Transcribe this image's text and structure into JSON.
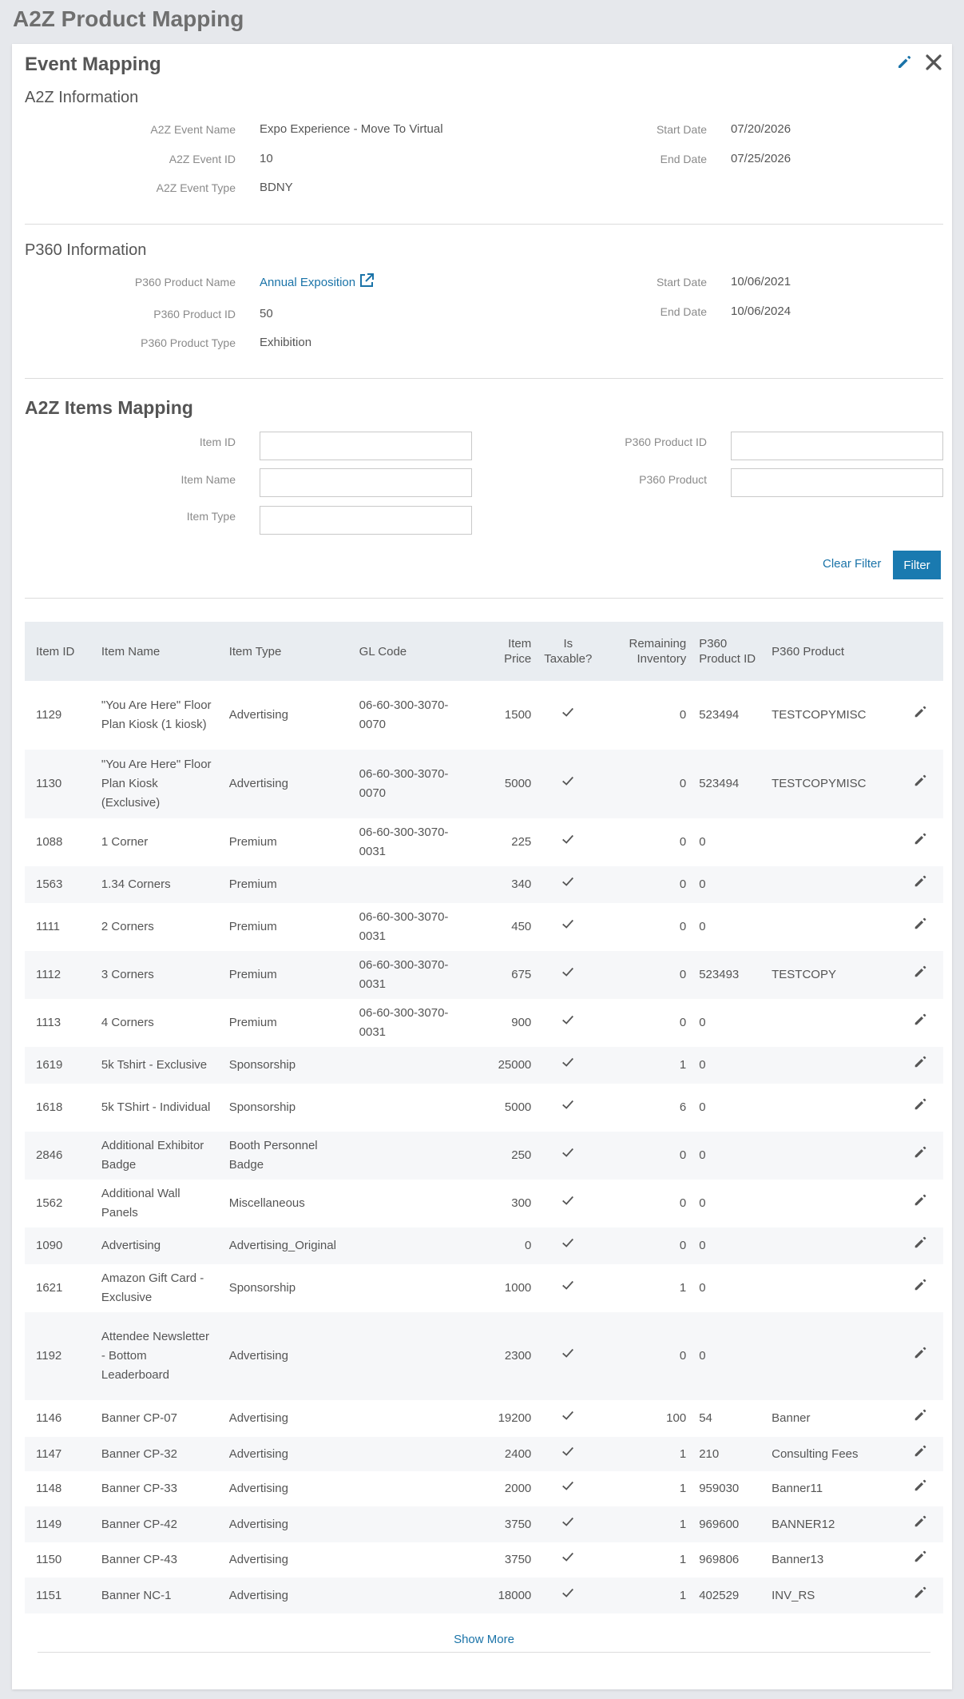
{
  "page_title": "A2Z Product Mapping",
  "card_title": "Event Mapping",
  "icons": {
    "edit": "pencil-icon",
    "close": "close-icon",
    "external": "external-link-icon",
    "check": "checkmark-icon"
  },
  "a2z_info": {
    "title": "A2Z Information",
    "event_name_label": "A2Z Event Name",
    "event_name": "Expo Experience - Move To Virtual",
    "event_id_label": "A2Z Event ID",
    "event_id": "10",
    "event_type_label": "A2Z Event Type",
    "event_type": "BDNY",
    "start_label": "Start Date",
    "start": "07/20/2026",
    "end_label": "End Date",
    "end": "07/25/2026"
  },
  "p360_info": {
    "title": "P360 Information",
    "product_name_label": "P360 Product Name",
    "product_name": "Annual Exposition",
    "product_id_label": "P360 Product ID",
    "product_id": "50",
    "product_type_label": "P360 Product Type",
    "product_type": "Exhibition",
    "start_label": "Start Date",
    "start": "10/06/2021",
    "end_label": "End Date",
    "end": "10/06/2024"
  },
  "items_mapping": {
    "title": "A2Z Items Mapping",
    "filters": {
      "item_id_label": "Item ID",
      "item_name_label": "Item Name",
      "item_type_label": "Item Type",
      "p360_product_id_label": "P360 Product ID",
      "p360_product_label": "P360 Product"
    },
    "clear_filter": "Clear Filter",
    "filter": "Filter",
    "columns": [
      "Item ID",
      "Item Name",
      "Item Type",
      "GL Code",
      "Item Price",
      "Is Taxable?",
      "Remaining Inventory",
      "P360 Product ID",
      "P360 Product"
    ],
    "rows": [
      {
        "id": "1129",
        "name": "\"You Are Here\" Floor Plan Kiosk (1 kiosk)",
        "type": "Advertising",
        "gl": "06-60-300-3070-0070",
        "price": "1500",
        "taxable": true,
        "inventory": "0",
        "p360_id": "523494",
        "p360_product": "TESTCOPYMISC"
      },
      {
        "id": "1130",
        "name": "\"You Are Here\" Floor Plan Kiosk (Exclusive)",
        "type": "Advertising",
        "gl": "06-60-300-3070-0070",
        "price": "5000",
        "taxable": true,
        "inventory": "0",
        "p360_id": "523494",
        "p360_product": "TESTCOPYMISC"
      },
      {
        "id": "1088",
        "name": "1 Corner",
        "type": "Premium",
        "gl": "06-60-300-3070-0031",
        "price": "225",
        "taxable": true,
        "inventory": "0",
        "p360_id": "0",
        "p360_product": ""
      },
      {
        "id": "1563",
        "name": "1.34 Corners",
        "type": "Premium",
        "gl": "",
        "price": "340",
        "taxable": true,
        "inventory": "0",
        "p360_id": "0",
        "p360_product": ""
      },
      {
        "id": "1111",
        "name": "2 Corners",
        "type": "Premium",
        "gl": "06-60-300-3070-0031",
        "price": "450",
        "taxable": true,
        "inventory": "0",
        "p360_id": "0",
        "p360_product": ""
      },
      {
        "id": "1112",
        "name": "3 Corners",
        "type": "Premium",
        "gl": "06-60-300-3070-0031",
        "price": "675",
        "taxable": true,
        "inventory": "0",
        "p360_id": "523493",
        "p360_product": "TESTCOPY"
      },
      {
        "id": "1113",
        "name": "4 Corners",
        "type": "Premium",
        "gl": "06-60-300-3070-0031",
        "price": "900",
        "taxable": true,
        "inventory": "0",
        "p360_id": "0",
        "p360_product": ""
      },
      {
        "id": "1619",
        "name": "5k Tshirt - Exclusive",
        "type": "Sponsorship",
        "gl": "",
        "price": "25000",
        "taxable": true,
        "inventory": "1",
        "p360_id": "0",
        "p360_product": ""
      },
      {
        "id": "1618",
        "name": "5k TShirt - Individual",
        "type": "Sponsorship",
        "gl": "",
        "price": "5000",
        "taxable": true,
        "inventory": "6",
        "p360_id": "0",
        "p360_product": ""
      },
      {
        "id": "2846",
        "name": "Additional Exhibitor Badge",
        "type": "Booth Personnel Badge",
        "gl": "",
        "price": "250",
        "taxable": true,
        "inventory": "0",
        "p360_id": "0",
        "p360_product": ""
      },
      {
        "id": "1562",
        "name": "Additional Wall Panels",
        "type": "Miscellaneous",
        "gl": "",
        "price": "300",
        "taxable": true,
        "inventory": "0",
        "p360_id": "0",
        "p360_product": ""
      },
      {
        "id": "1090",
        "name": "Advertising",
        "type": "Advertising_Original",
        "gl": "",
        "price": "0",
        "taxable": true,
        "inventory": "0",
        "p360_id": "0",
        "p360_product": ""
      },
      {
        "id": "1621",
        "name": "Amazon Gift Card - Exclusive",
        "type": "Sponsorship",
        "gl": "",
        "price": "1000",
        "taxable": true,
        "inventory": "1",
        "p360_id": "0",
        "p360_product": ""
      },
      {
        "id": "1192",
        "name": "Attendee Newsletter - Bottom Leaderboard",
        "type": "Advertising",
        "gl": "",
        "price": "2300",
        "taxable": true,
        "inventory": "0",
        "p360_id": "0",
        "p360_product": ""
      },
      {
        "id": "1146",
        "name": "Banner CP-07",
        "type": "Advertising",
        "gl": "",
        "price": "19200",
        "taxable": true,
        "inventory": "100",
        "p360_id": "54",
        "p360_product": "Banner"
      },
      {
        "id": "1147",
        "name": "Banner CP-32",
        "type": "Advertising",
        "gl": "",
        "price": "2400",
        "taxable": true,
        "inventory": "1",
        "p360_id": "210",
        "p360_product": "Consulting Fees"
      },
      {
        "id": "1148",
        "name": "Banner CP-33",
        "type": "Advertising",
        "gl": "",
        "price": "2000",
        "taxable": true,
        "inventory": "1",
        "p360_id": "959030",
        "p360_product": "Banner11"
      },
      {
        "id": "1149",
        "name": "Banner CP-42",
        "type": "Advertising",
        "gl": "",
        "price": "3750",
        "taxable": true,
        "inventory": "1",
        "p360_id": "969600",
        "p360_product": "BANNER12"
      },
      {
        "id": "1150",
        "name": "Banner CP-43",
        "type": "Advertising",
        "gl": "",
        "price": "3750",
        "taxable": true,
        "inventory": "1",
        "p360_id": "969806",
        "p360_product": "Banner13"
      },
      {
        "id": "1151",
        "name": "Banner NC-1",
        "type": "Advertising",
        "gl": "",
        "price": "18000",
        "taxable": true,
        "inventory": "1",
        "p360_id": "402529",
        "p360_product": "INV_RS"
      }
    ],
    "show_more": "Show More"
  },
  "colors": {
    "accent": "#1a7ab0",
    "link": "#1a73a8",
    "header_bg": "#e9edf1"
  }
}
